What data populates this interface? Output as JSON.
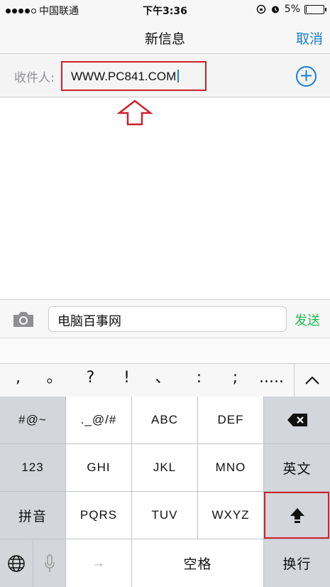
{
  "status": {
    "carrier": "中国联通",
    "time": "下午3:36",
    "battery": "5%",
    "battery_level": 0.05
  },
  "nav": {
    "title": "新信息",
    "cancel": "取消"
  },
  "recipient": {
    "label": "收件人:",
    "value": "WWW.PC841.COM",
    "add_icon": "plus-circle-icon"
  },
  "compose": {
    "camera_icon": "camera-icon",
    "message": "电脑百事网",
    "send": "发送"
  },
  "punctuation": [
    ",",
    "。",
    "?",
    "!",
    "、",
    ":",
    ";",
    "....."
  ],
  "keyboard": {
    "symbols": "#@~",
    "k1": "._@/#",
    "k2": "ABC",
    "k3": "DEF",
    "num": "123",
    "k4": "GHI",
    "k5": "JKL",
    "k6": "MNO",
    "english": "英文",
    "pinyin": "拼音",
    "k7": "PQRS",
    "k8": "TUV",
    "k9": "WXYZ",
    "arrow": "→",
    "space": "空格",
    "return": "换行"
  },
  "colors": {
    "accent": "#1a7fd6",
    "send": "#1db84a",
    "highlight": "#d0202a"
  }
}
